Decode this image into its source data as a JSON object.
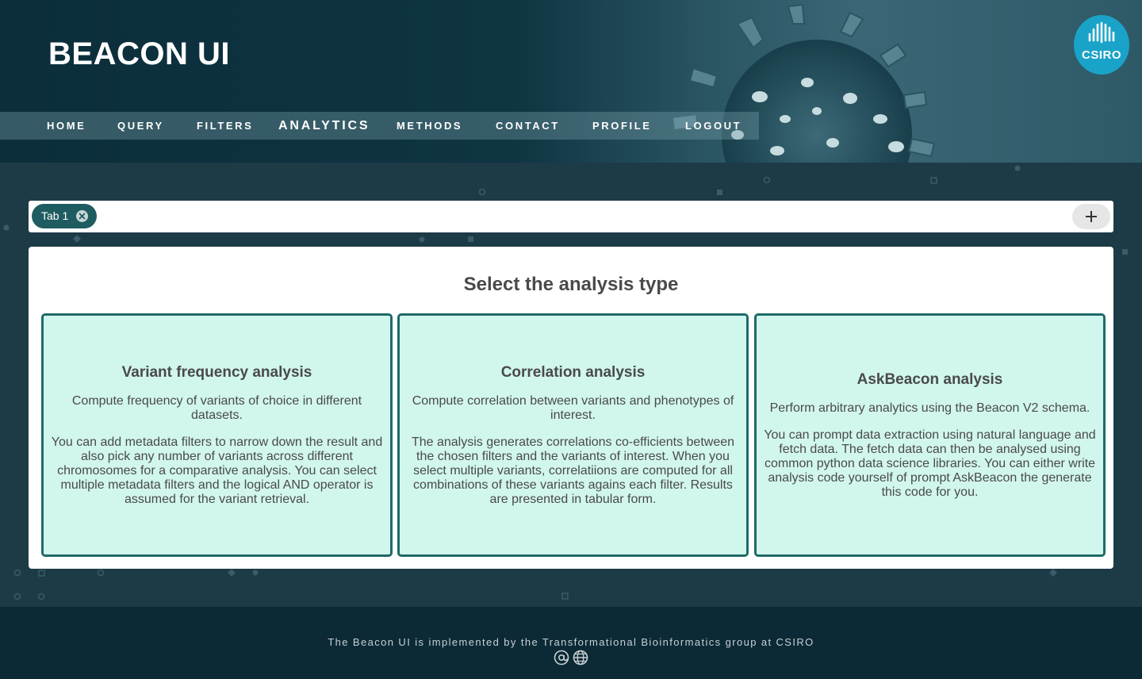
{
  "header": {
    "brand": "BEACON UI",
    "logo_text": "CSIRO",
    "nav": [
      {
        "label": "HOME"
      },
      {
        "label": "QUERY"
      },
      {
        "label": "FILTERS"
      },
      {
        "label": "ANALYTICS",
        "active": true
      },
      {
        "label": "METHODS"
      },
      {
        "label": "CONTACT"
      },
      {
        "label": "PROFILE"
      },
      {
        "label": "LOGOUT"
      }
    ]
  },
  "tabs": {
    "items": [
      {
        "label": "Tab 1"
      }
    ],
    "add_icon": "plus-icon",
    "close_icon": "close-circle-icon"
  },
  "main": {
    "title": "Select the analysis type",
    "cards": [
      {
        "title": "Variant frequency analysis",
        "subtitle": "Compute frequency of variants of choice in different datasets.",
        "body": "You can add metadata filters to narrow down the result and also pick any number of variants across different chromosomes for a comparative analysis. You can select multiple metadata filters and the logical AND operator is assumed for the variant retrieval."
      },
      {
        "title": "Correlation analysis",
        "subtitle": "Compute correlation between variants and phenotypes of interest.",
        "body": "The analysis generates correlations co-efficients between the chosen filters and the variants of interest. When you select multiple variants, correlatiions are computed for all combinations of these variants agains each filter. Results are presented in tabular form."
      },
      {
        "title": "AskBeacon analysis",
        "subtitle": "Perform arbitrary analytics using the Beacon V2 schema.",
        "body": "You can prompt data extraction using natural language and fetch data. The fetch data can then be analysed using common python data science libraries. You can either write analysis code yourself of prompt AskBeacon the generate this code for you."
      }
    ]
  },
  "footer": {
    "text": "The Beacon UI is implemented by the Transformational Bioinformatics group at CSIRO",
    "icons": [
      "at-sign-icon",
      "globe-icon"
    ]
  },
  "colors": {
    "accent": "#1f5c61",
    "card_bg": "#d1f6ee",
    "card_border": "#1f6a67",
    "logo": "#1aa3c8"
  }
}
